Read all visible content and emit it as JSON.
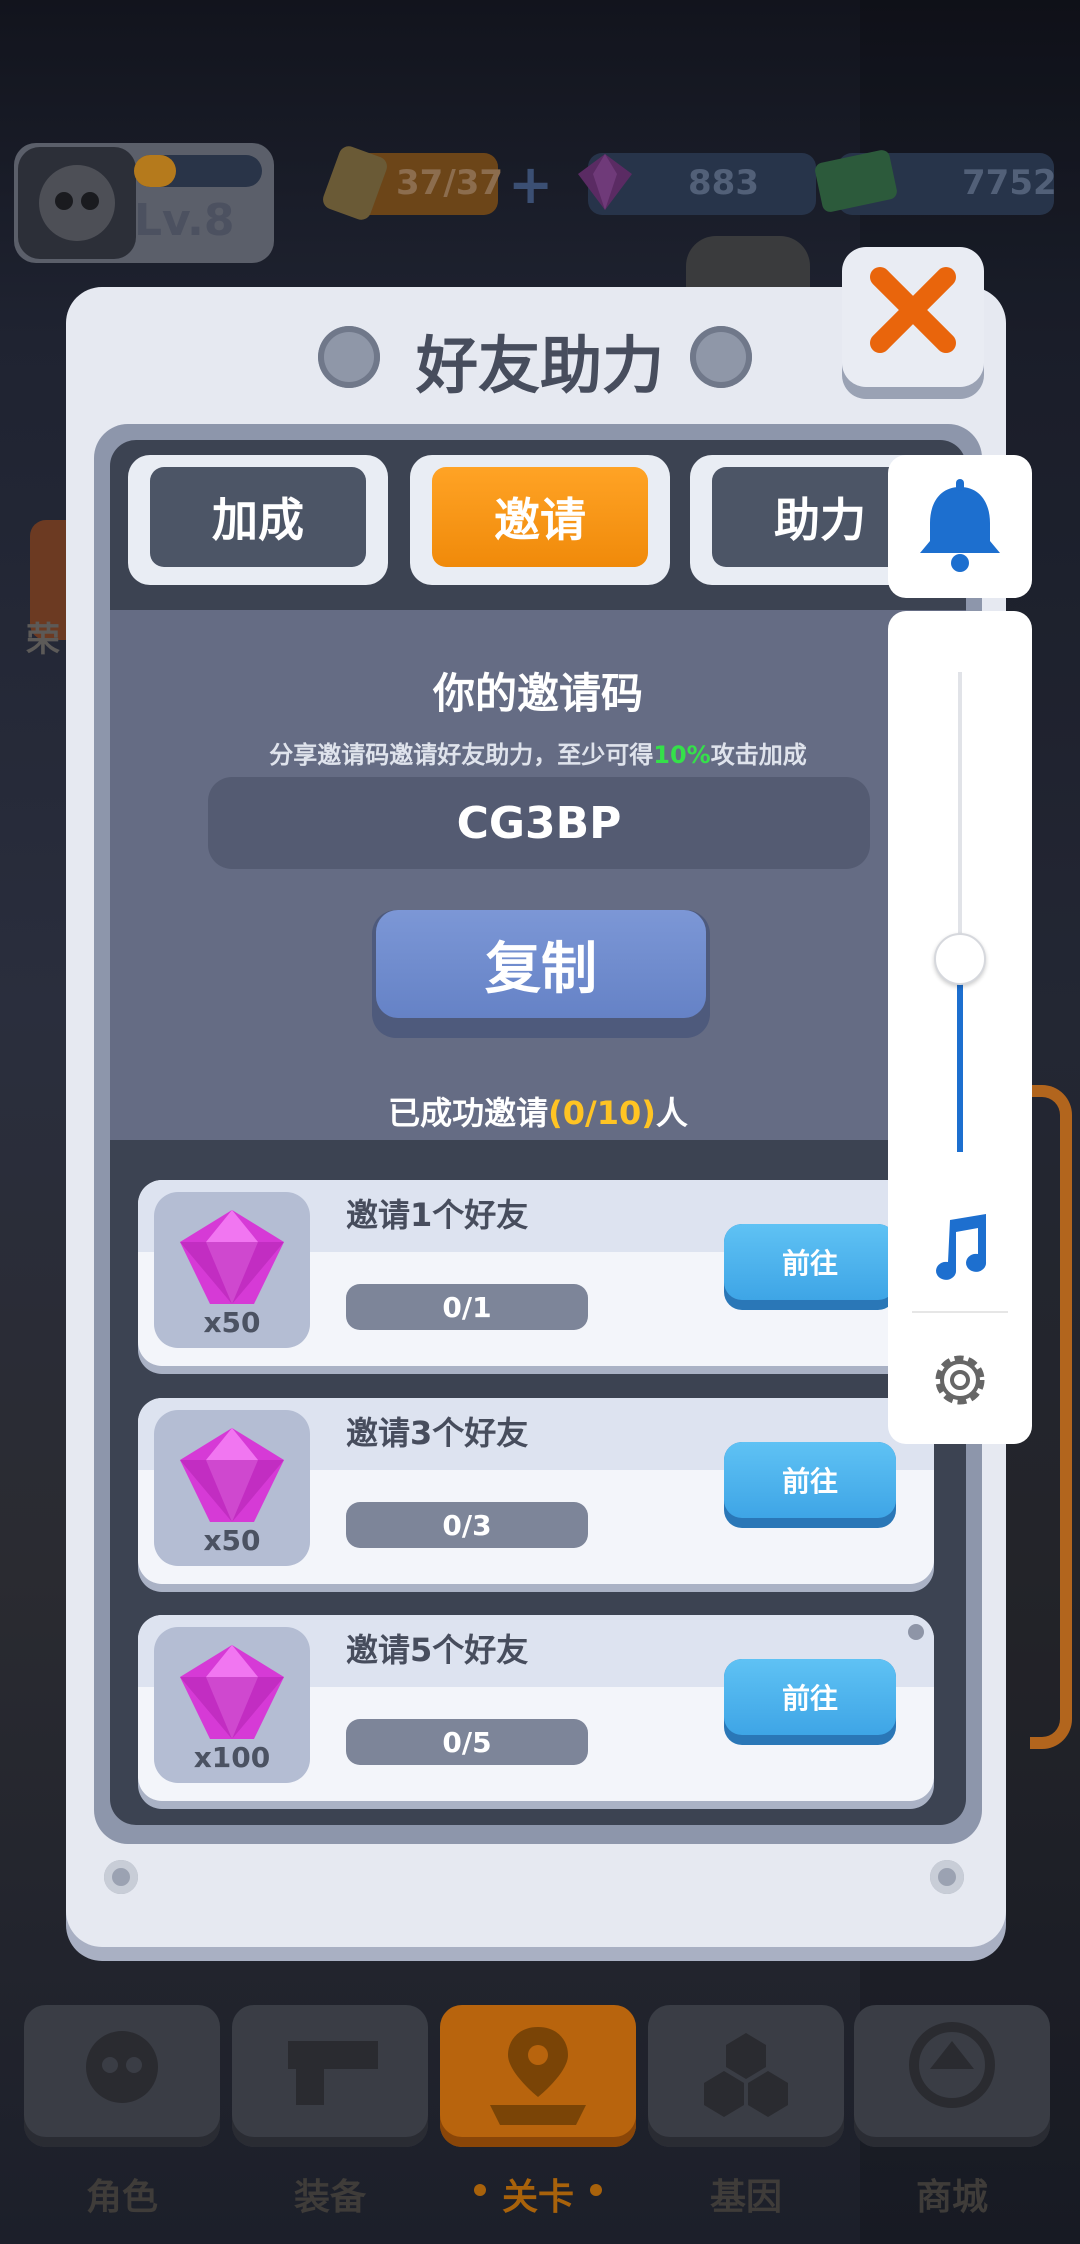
{
  "hud": {
    "level": "Lv.8",
    "energy": "37/37",
    "gems": "883",
    "cash": "7752"
  },
  "dialog": {
    "title": "好友助力",
    "tabs": [
      "加成",
      "邀请",
      "助力"
    ],
    "active_tab": "邀请",
    "code_label": "你的邀请码",
    "code_sub_prefix": "分享邀请码邀请好友助力，至少可得",
    "code_sub_highlight": "10%",
    "code_sub_suffix": "攻击加成",
    "code": "CG3BP",
    "copy_label": "复制",
    "invited_prefix": "已成功邀请",
    "invited_count": "(0/10)",
    "invited_suffix": "人",
    "tasks": [
      {
        "name": "邀请1个好友",
        "reward": "x50",
        "progress": "0/1",
        "button": "前往"
      },
      {
        "name": "邀请3个好友",
        "reward": "x50",
        "progress": "0/3",
        "button": "前往"
      },
      {
        "name": "邀请5个好友",
        "reward": "x100",
        "progress": "0/5",
        "button": "前往"
      }
    ]
  },
  "bottom_nav": {
    "items": [
      "角色",
      "装备",
      "关卡",
      "基因",
      "商城"
    ],
    "active": "关卡"
  },
  "side_partial_label": "荣",
  "volume": {
    "level_fraction": 0.4
  },
  "colors": {
    "accent_orange": "#f6970f",
    "gem_purple": "#d63ad6",
    "system_blue": "#1d6fcf",
    "highlight_green": "#35e04a",
    "highlight_yellow": "#ffc423"
  }
}
